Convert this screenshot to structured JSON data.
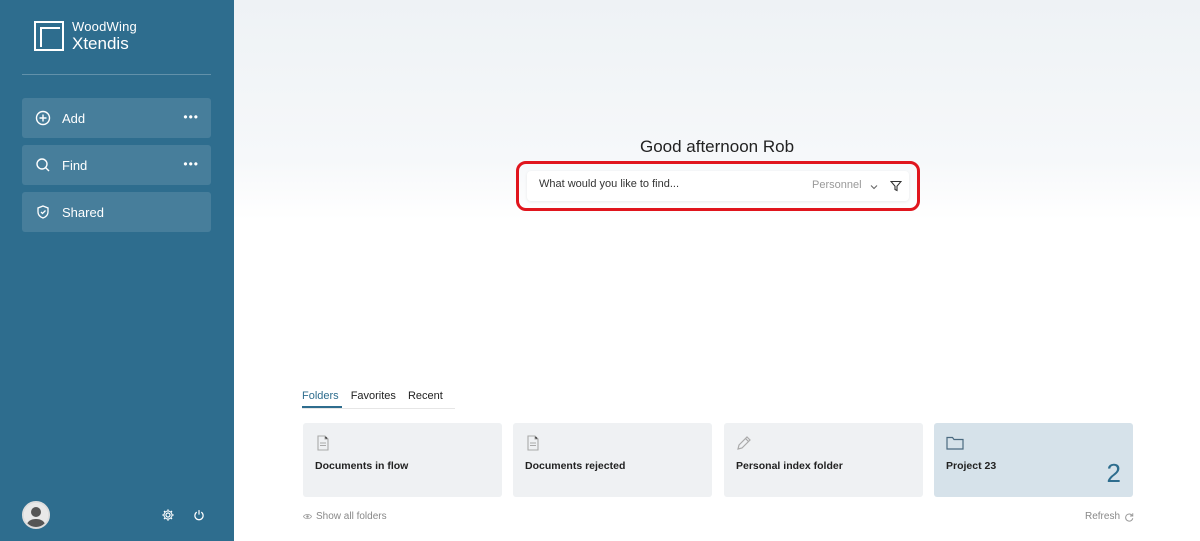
{
  "app": {
    "brand": "WoodWing",
    "product": "Xtendis"
  },
  "sidebar": {
    "items": [
      {
        "label": "Add",
        "icon": "plus-circle-icon",
        "more": "•••"
      },
      {
        "label": "Find",
        "icon": "search-icon",
        "more": "•••"
      },
      {
        "label": "Shared",
        "icon": "shield-icon"
      }
    ],
    "footer_icons": [
      "user-avatar",
      "gear-icon",
      "power-icon"
    ]
  },
  "main": {
    "greeting": "Good afternoon Rob",
    "search": {
      "placeholder": "What would you like to find...",
      "scope": "Personnel"
    },
    "tabs": [
      {
        "label": "Folders",
        "active": true
      },
      {
        "label": "Favorites",
        "active": false
      },
      {
        "label": "Recent",
        "active": false
      }
    ],
    "cards": [
      {
        "title": "Documents in flow",
        "icon": "document-icon"
      },
      {
        "title": "Documents rejected",
        "icon": "document-icon"
      },
      {
        "title": "Personal index folder",
        "icon": "pencil-icon"
      },
      {
        "title": "Project 23",
        "icon": "folder-icon",
        "count": "2"
      }
    ],
    "show_all": "Show all folders",
    "refresh": "Refresh"
  },
  "colors": {
    "sidebar_bg": "#2e6d8e",
    "accent": "#2e6d8e",
    "highlight_border": "#e0151d",
    "card_bg": "#eff1f3",
    "card_highlight_bg": "#d6e2ea"
  }
}
